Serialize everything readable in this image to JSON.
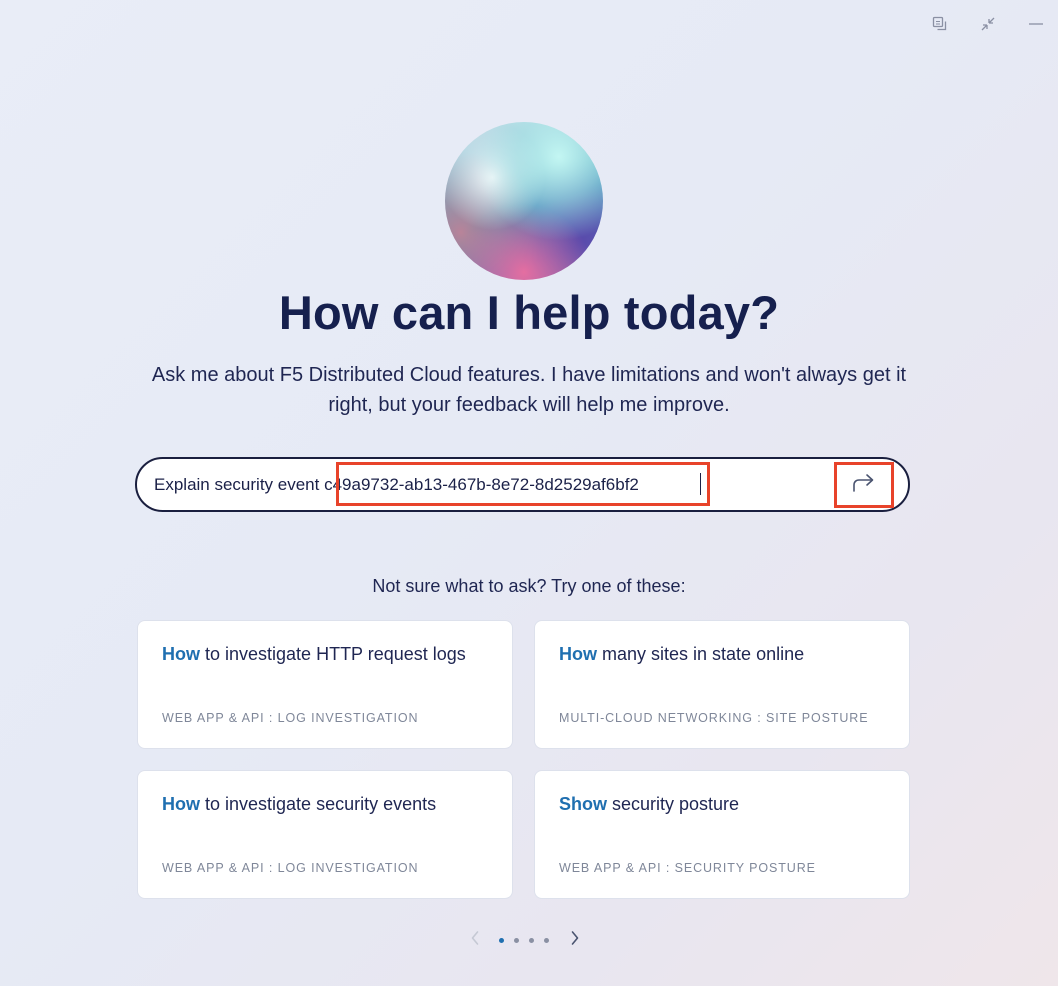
{
  "window_controls": [
    {
      "icon": "copy-window-icon"
    },
    {
      "icon": "minimize-arrows-icon"
    },
    {
      "icon": "minus-icon"
    }
  ],
  "hero": {
    "title": "How can I help today?",
    "subtitle": "Ask me about F5 Distributed Cloud features. I have limitations and won't always get it right, but your feedback will help me improve."
  },
  "prompt": {
    "prefix": "Explain security event ",
    "event_id": "c49a9732-ab13-467b-8e72-8d2529af6bf2",
    "send_icon": "share-arrow-icon",
    "highlight_color": "#e8432a"
  },
  "suggestions": {
    "heading": "Not sure what to ask? Try one of these:",
    "cards": [
      {
        "keyword": "How",
        "rest": " to investigate HTTP request logs",
        "tag": "WEB APP & API : LOG INVESTIGATION"
      },
      {
        "keyword": "How",
        "rest": " many sites in state online",
        "tag": "MULTI-CLOUD NETWORKING : SITE POSTURE"
      },
      {
        "keyword": "How",
        "rest": " to investigate security events",
        "tag": "WEB APP & API : LOG INVESTIGATION"
      },
      {
        "keyword": "Show",
        "rest": " security posture",
        "tag": "WEB APP & API : SECURITY POSTURE"
      }
    ],
    "keyword_color": "#1f6fb0"
  },
  "pager": {
    "total_pages": 4,
    "current_page": 1,
    "prev_icon": "chevron-left-icon",
    "next_icon": "chevron-right-icon"
  }
}
